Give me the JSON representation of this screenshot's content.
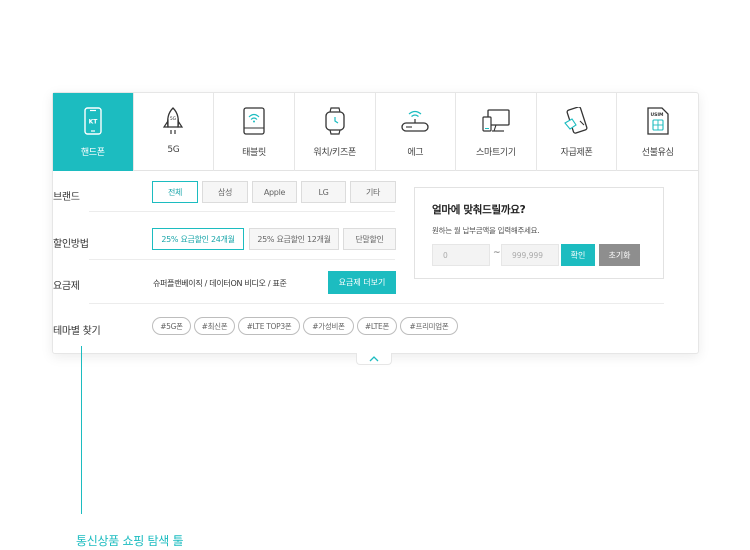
{
  "colors": {
    "accent": "#1cbcc0",
    "tab_active_bg": "#1cbcc0",
    "gray_button": "#8e8e8e"
  },
  "tabs": [
    {
      "label": "핸드폰",
      "icon": "phone-icon",
      "active": true
    },
    {
      "label": "5G",
      "icon": "rocket-5g-icon",
      "active": false
    },
    {
      "label": "태블릿",
      "icon": "tablet-icon",
      "active": false
    },
    {
      "label": "워치/키즈폰",
      "icon": "watch-icon",
      "active": false
    },
    {
      "label": "에그",
      "icon": "egg-router-icon",
      "active": false
    },
    {
      "label": "스마트기기",
      "icon": "smart-device-icon",
      "active": false
    },
    {
      "label": "자급제폰",
      "icon": "unlocked-phone-icon",
      "active": false
    },
    {
      "label": "선불유심",
      "icon": "usim-icon",
      "active": false
    }
  ],
  "usim_icon_text": "USIM",
  "brand": {
    "label": "브랜드",
    "options": [
      "전체",
      "삼성",
      "Apple",
      "LG",
      "기타"
    ],
    "selected": "전체"
  },
  "discount": {
    "label": "할인방법",
    "options": [
      "25% 요금할인 24개월",
      "25% 요금할인 12개월",
      "단말할인"
    ],
    "selected": "25% 요금할인 24개월"
  },
  "plan": {
    "label": "요금제",
    "value": "슈퍼플랜베이직 / 데이터ON 비디오 / 표준",
    "more_button": "요금제 더보기"
  },
  "theme": {
    "label": "테마별 찾기",
    "tags": [
      "#5G폰",
      "#최신폰",
      "#LTE TOP3폰",
      "#가성비폰",
      "#LTE폰",
      "#프리미엄폰"
    ]
  },
  "price_box": {
    "title": "얼마에 맞춰드릴까요?",
    "subtitle": "원하는 월 납부금액을 입력해주세요.",
    "min_placeholder": "0",
    "max_placeholder": "999,999",
    "separator": "~",
    "confirm": "확인",
    "reset": "초기화"
  },
  "collapse_icon": "chevron-up-icon",
  "caption": "통신상품 쇼핑 탐색 툴"
}
